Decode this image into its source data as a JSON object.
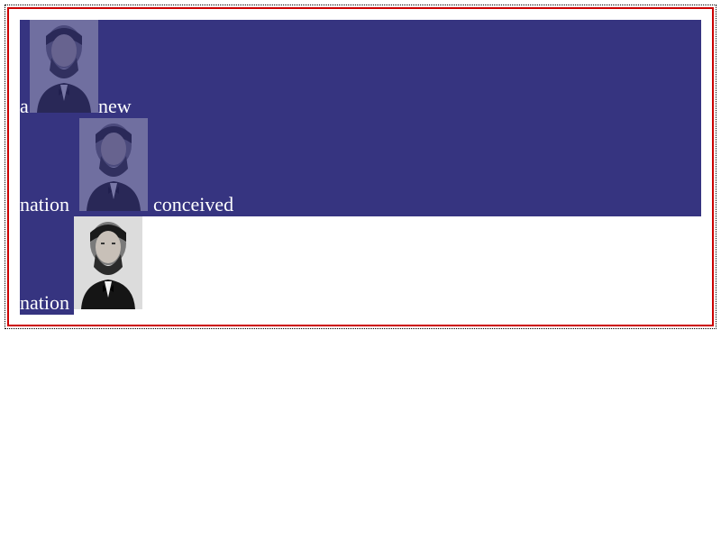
{
  "colors": {
    "panel_blue": "#363480",
    "border_red": "#cc0000",
    "tint_overlay": "#363480"
  },
  "words": {
    "w1": "a",
    "w2": "new",
    "w3": "nation",
    "w4": "conceived",
    "w5": "nation"
  },
  "images": {
    "img1": "lincoln-portrait-tinted",
    "img2": "lincoln-portrait-tinted",
    "img3": "lincoln-portrait"
  }
}
